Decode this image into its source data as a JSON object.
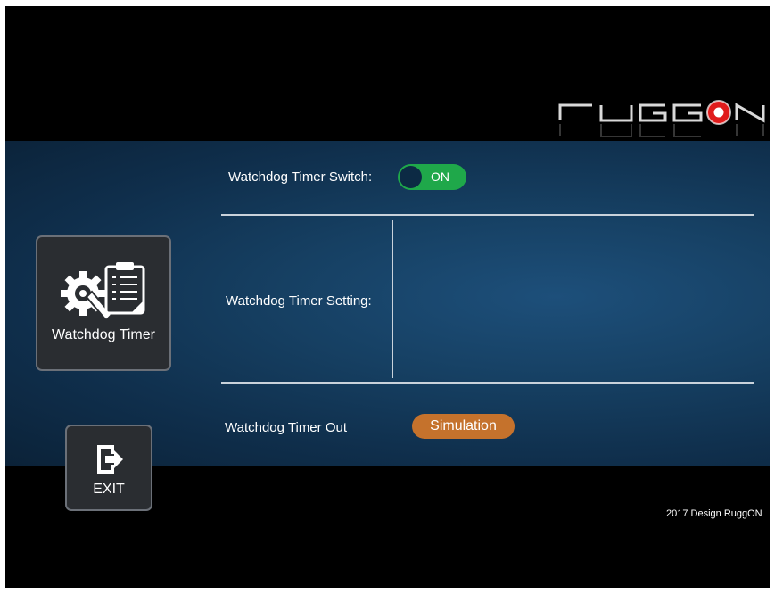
{
  "brand": {
    "logo_text": "RUGGON"
  },
  "sidebar": {
    "watchdog_label": "Watchdog Timer",
    "exit_label": "EXIT"
  },
  "main": {
    "switch_label": "Watchdog Timer Switch:",
    "switch_state": "ON",
    "setting_label": "Watchdog Timer Setting:",
    "timer_out_label": "Watchdog Timer Out",
    "simulation_label": "Simulation"
  },
  "footer": {
    "text": "2017 Design RuggON"
  },
  "colors": {
    "toggle_on": "#1fa84a",
    "simulation_button": "#c5722c",
    "panel": "#164063",
    "logo_red": "#e01b1b"
  }
}
